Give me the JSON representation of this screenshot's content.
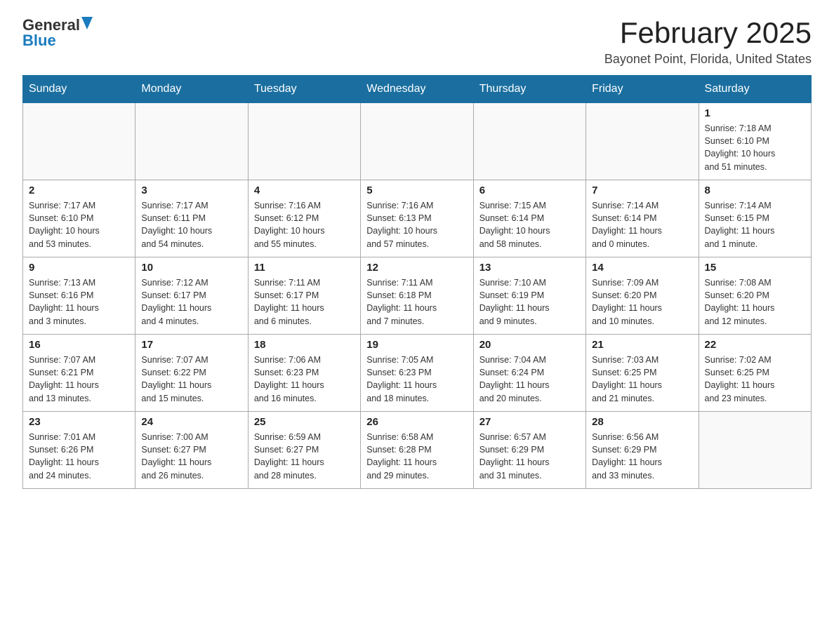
{
  "header": {
    "logo_general": "General",
    "logo_blue": "Blue",
    "title": "February 2025",
    "subtitle": "Bayonet Point, Florida, United States"
  },
  "days_of_week": [
    "Sunday",
    "Monday",
    "Tuesday",
    "Wednesday",
    "Thursday",
    "Friday",
    "Saturday"
  ],
  "weeks": [
    [
      {
        "day": "",
        "info": ""
      },
      {
        "day": "",
        "info": ""
      },
      {
        "day": "",
        "info": ""
      },
      {
        "day": "",
        "info": ""
      },
      {
        "day": "",
        "info": ""
      },
      {
        "day": "",
        "info": ""
      },
      {
        "day": "1",
        "info": "Sunrise: 7:18 AM\nSunset: 6:10 PM\nDaylight: 10 hours\nand 51 minutes."
      }
    ],
    [
      {
        "day": "2",
        "info": "Sunrise: 7:17 AM\nSunset: 6:10 PM\nDaylight: 10 hours\nand 53 minutes."
      },
      {
        "day": "3",
        "info": "Sunrise: 7:17 AM\nSunset: 6:11 PM\nDaylight: 10 hours\nand 54 minutes."
      },
      {
        "day": "4",
        "info": "Sunrise: 7:16 AM\nSunset: 6:12 PM\nDaylight: 10 hours\nand 55 minutes."
      },
      {
        "day": "5",
        "info": "Sunrise: 7:16 AM\nSunset: 6:13 PM\nDaylight: 10 hours\nand 57 minutes."
      },
      {
        "day": "6",
        "info": "Sunrise: 7:15 AM\nSunset: 6:14 PM\nDaylight: 10 hours\nand 58 minutes."
      },
      {
        "day": "7",
        "info": "Sunrise: 7:14 AM\nSunset: 6:14 PM\nDaylight: 11 hours\nand 0 minutes."
      },
      {
        "day": "8",
        "info": "Sunrise: 7:14 AM\nSunset: 6:15 PM\nDaylight: 11 hours\nand 1 minute."
      }
    ],
    [
      {
        "day": "9",
        "info": "Sunrise: 7:13 AM\nSunset: 6:16 PM\nDaylight: 11 hours\nand 3 minutes."
      },
      {
        "day": "10",
        "info": "Sunrise: 7:12 AM\nSunset: 6:17 PM\nDaylight: 11 hours\nand 4 minutes."
      },
      {
        "day": "11",
        "info": "Sunrise: 7:11 AM\nSunset: 6:17 PM\nDaylight: 11 hours\nand 6 minutes."
      },
      {
        "day": "12",
        "info": "Sunrise: 7:11 AM\nSunset: 6:18 PM\nDaylight: 11 hours\nand 7 minutes."
      },
      {
        "day": "13",
        "info": "Sunrise: 7:10 AM\nSunset: 6:19 PM\nDaylight: 11 hours\nand 9 minutes."
      },
      {
        "day": "14",
        "info": "Sunrise: 7:09 AM\nSunset: 6:20 PM\nDaylight: 11 hours\nand 10 minutes."
      },
      {
        "day": "15",
        "info": "Sunrise: 7:08 AM\nSunset: 6:20 PM\nDaylight: 11 hours\nand 12 minutes."
      }
    ],
    [
      {
        "day": "16",
        "info": "Sunrise: 7:07 AM\nSunset: 6:21 PM\nDaylight: 11 hours\nand 13 minutes."
      },
      {
        "day": "17",
        "info": "Sunrise: 7:07 AM\nSunset: 6:22 PM\nDaylight: 11 hours\nand 15 minutes."
      },
      {
        "day": "18",
        "info": "Sunrise: 7:06 AM\nSunset: 6:23 PM\nDaylight: 11 hours\nand 16 minutes."
      },
      {
        "day": "19",
        "info": "Sunrise: 7:05 AM\nSunset: 6:23 PM\nDaylight: 11 hours\nand 18 minutes."
      },
      {
        "day": "20",
        "info": "Sunrise: 7:04 AM\nSunset: 6:24 PM\nDaylight: 11 hours\nand 20 minutes."
      },
      {
        "day": "21",
        "info": "Sunrise: 7:03 AM\nSunset: 6:25 PM\nDaylight: 11 hours\nand 21 minutes."
      },
      {
        "day": "22",
        "info": "Sunrise: 7:02 AM\nSunset: 6:25 PM\nDaylight: 11 hours\nand 23 minutes."
      }
    ],
    [
      {
        "day": "23",
        "info": "Sunrise: 7:01 AM\nSunset: 6:26 PM\nDaylight: 11 hours\nand 24 minutes."
      },
      {
        "day": "24",
        "info": "Sunrise: 7:00 AM\nSunset: 6:27 PM\nDaylight: 11 hours\nand 26 minutes."
      },
      {
        "day": "25",
        "info": "Sunrise: 6:59 AM\nSunset: 6:27 PM\nDaylight: 11 hours\nand 28 minutes."
      },
      {
        "day": "26",
        "info": "Sunrise: 6:58 AM\nSunset: 6:28 PM\nDaylight: 11 hours\nand 29 minutes."
      },
      {
        "day": "27",
        "info": "Sunrise: 6:57 AM\nSunset: 6:29 PM\nDaylight: 11 hours\nand 31 minutes."
      },
      {
        "day": "28",
        "info": "Sunrise: 6:56 AM\nSunset: 6:29 PM\nDaylight: 11 hours\nand 33 minutes."
      },
      {
        "day": "",
        "info": ""
      }
    ]
  ]
}
